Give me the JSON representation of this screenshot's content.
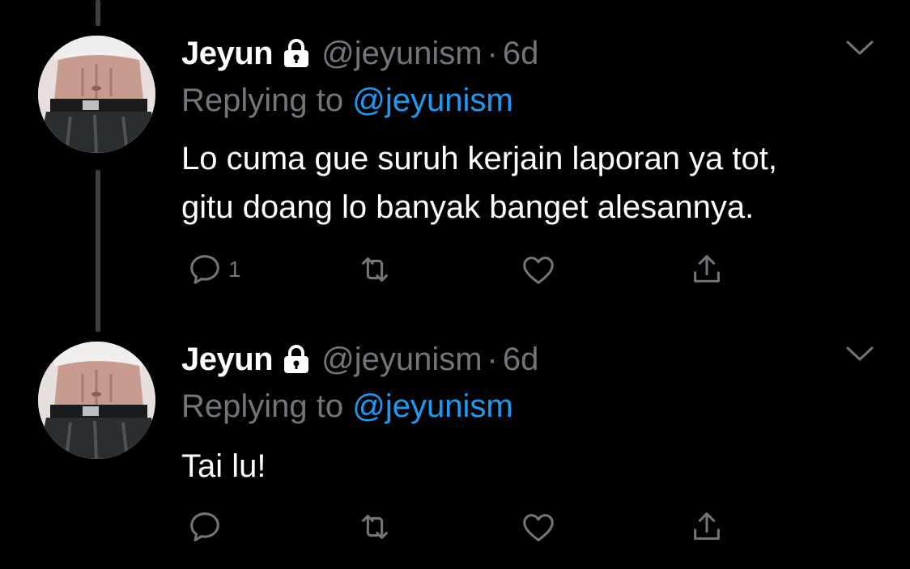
{
  "tweets": [
    {
      "name": "Jeyun",
      "handle": "@jeyunism",
      "separator": "·",
      "time": "6d",
      "replying_prefix": "Replying to",
      "replying_to": "@jeyunism",
      "text_lines": [
        "Lo cuma gue suruh kerjain laporan ya tot,",
        "gitu doang lo banyak banget alesannya."
      ],
      "reply_count": "1"
    },
    {
      "name": "Jeyun",
      "handle": "@jeyunism",
      "separator": "·",
      "time": "6d",
      "replying_prefix": "Replying to",
      "replying_to": "@jeyunism",
      "text_lines": [
        "Tai lu!"
      ],
      "reply_count": ""
    }
  ],
  "colors": {
    "background": "#000000",
    "secondary_text": "#71767b",
    "accent": "#1d9bf0",
    "thread_line": "#3d4144"
  },
  "icons": [
    "lock-icon",
    "chevron-down-icon",
    "reply-icon",
    "retweet-icon",
    "like-icon",
    "share-icon"
  ]
}
